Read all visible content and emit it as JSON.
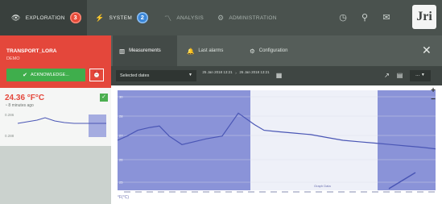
{
  "colors": {
    "topbar": "#4a524e",
    "alarm_red": "#e4473b",
    "ack_green": "#3fae4c",
    "chart_line": "#4a56b5",
    "chart_band": "#8a93d8"
  },
  "nav": {
    "tabs": [
      {
        "icon": "eye-icon",
        "label": "EXPLORATION",
        "badge": "3"
      },
      {
        "icon": "lightning-icon",
        "label": "SYSTEM",
        "badge": "2"
      },
      {
        "icon": "chart-line-icon",
        "label": "ANALYSIS"
      },
      {
        "icon": "admin-icon",
        "label": "ADMINISTRATION"
      }
    ],
    "logo_text": "Jri"
  },
  "device": {
    "name": "TRANSPORT_LORA",
    "subtitle": "DEMO",
    "ack_label": "ACKNOWLEDGE...",
    "sensor_value": "24.36 °F°C",
    "sensor_time": "8 minutes ago",
    "scale_top": "0.286",
    "scale_bottom": "0.288"
  },
  "panel": {
    "tabs": [
      "Measurements",
      "Last alarms",
      "Configuration"
    ]
  },
  "toolbar": {
    "range_label": "Selected dates",
    "date_from": "25 Jan 2018 13:21",
    "date_to": "26 Jan 2018 13:21",
    "more_label": "..."
  },
  "chart_data": {
    "type": "line",
    "x": [
      0,
      12,
      25,
      40,
      52,
      64,
      80,
      95,
      110,
      130,
      150,
      170,
      182,
      200,
      220,
      240,
      260,
      280,
      300,
      320,
      340,
      360,
      380,
      395
    ],
    "y": [
      27.5,
      27.8,
      28.2,
      28.4,
      28.5,
      27.8,
      27.2,
      27.4,
      27.6,
      27.8,
      29.4,
      28.6,
      28.2,
      28.1,
      28.0,
      27.9,
      27.7,
      27.5,
      27.4,
      27.3,
      27.2,
      27.1,
      27.0,
      26.9
    ],
    "y_ticks": [
      "30",
      "28",
      "27",
      "26",
      "25"
    ],
    "ylim": [
      24,
      31
    ],
    "bands": [
      [
        0,
        165
      ],
      [
        323,
        395
      ]
    ],
    "legend_label": "°F(°C)",
    "axis_label": "Graph Data"
  }
}
